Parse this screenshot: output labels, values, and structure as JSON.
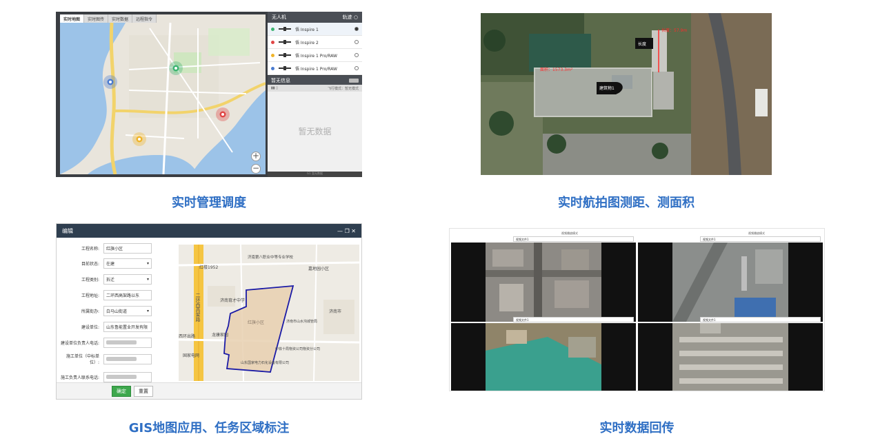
{
  "captions": {
    "p1": "实时管理调度",
    "p2": "实时航拍图测距、测面积",
    "p3": "GIS地图应用、任务区域标注",
    "p4": "实时数据回传"
  },
  "panel1": {
    "tabs": [
      "实时地图",
      "实时图传",
      "实时数据",
      "远程指令"
    ],
    "drone_header": "无人机",
    "track_label": "轨迹",
    "drones": [
      {
        "name": "悟 Inspire 1",
        "color": "#3cb371"
      },
      {
        "name": "悟 Inspire 2",
        "color": "#e04646"
      },
      {
        "name": "悟 Inspire 1 Pro/RAW",
        "color": "#f0b429"
      },
      {
        "name": "悟 Inspire 1 Pro/RAW",
        "color": "#4a7bd0"
      }
    ],
    "info_header": "暂无信息",
    "info_sub_right": "飞行模式：暂无模式",
    "no_data": "暂无数据",
    "footer": "G1 暂无数据",
    "zoom_in": "+",
    "zoom_out": "−"
  },
  "panel2": {
    "label_length": "长度",
    "label_building": "建筑物1",
    "measure_length": "长度：57.9m",
    "measure_area": "面积：1573.3m²"
  },
  "panel3": {
    "title": "编辑",
    "window_controls": "— ❐ ✕",
    "fields": [
      {
        "label": "工程名称:",
        "value": "红旗小区",
        "select": false,
        "blur": false
      },
      {
        "label": "目前状态:",
        "value": "在建",
        "select": true,
        "blur": false
      },
      {
        "label": "工程类别:",
        "value": "拆迁",
        "select": true,
        "blur": false
      },
      {
        "label": "工程地址:",
        "value": "二环西高架路以东",
        "select": false,
        "blur": false
      },
      {
        "label": "所属街办:",
        "value": "白马山街道",
        "select": true,
        "blur": false
      },
      {
        "label": "建设单位:",
        "value": "山东鲁能置业开发有限",
        "select": false,
        "blur": false
      },
      {
        "label": "建设单位负责人电话:",
        "value": "",
        "select": false,
        "blur": true
      },
      {
        "label": "施工单位（中标单位）:",
        "value": "",
        "select": false,
        "blur": true
      },
      {
        "label": "施工负责人联系电话:",
        "value": "",
        "select": false,
        "blur": true
      }
    ],
    "buttons": {
      "confirm": "确定",
      "reset": "重置"
    },
    "map_labels": [
      "济南第八职业中等专业学校",
      "红楼1952",
      "嘉地园小区",
      "济南育才中学",
      "龙康家园",
      "西环出路",
      "国家电网",
      "山东国家电力石化设备有限公司",
      "中铁十局物资公司物资分公司",
      "济南市山水沟城管局",
      "济南市"
    ],
    "road_label": "二环西高架路",
    "area_label": "红旗小区"
  },
  "panel4": {
    "select_label": "视频播放模式",
    "select_value": "视频文件1"
  }
}
